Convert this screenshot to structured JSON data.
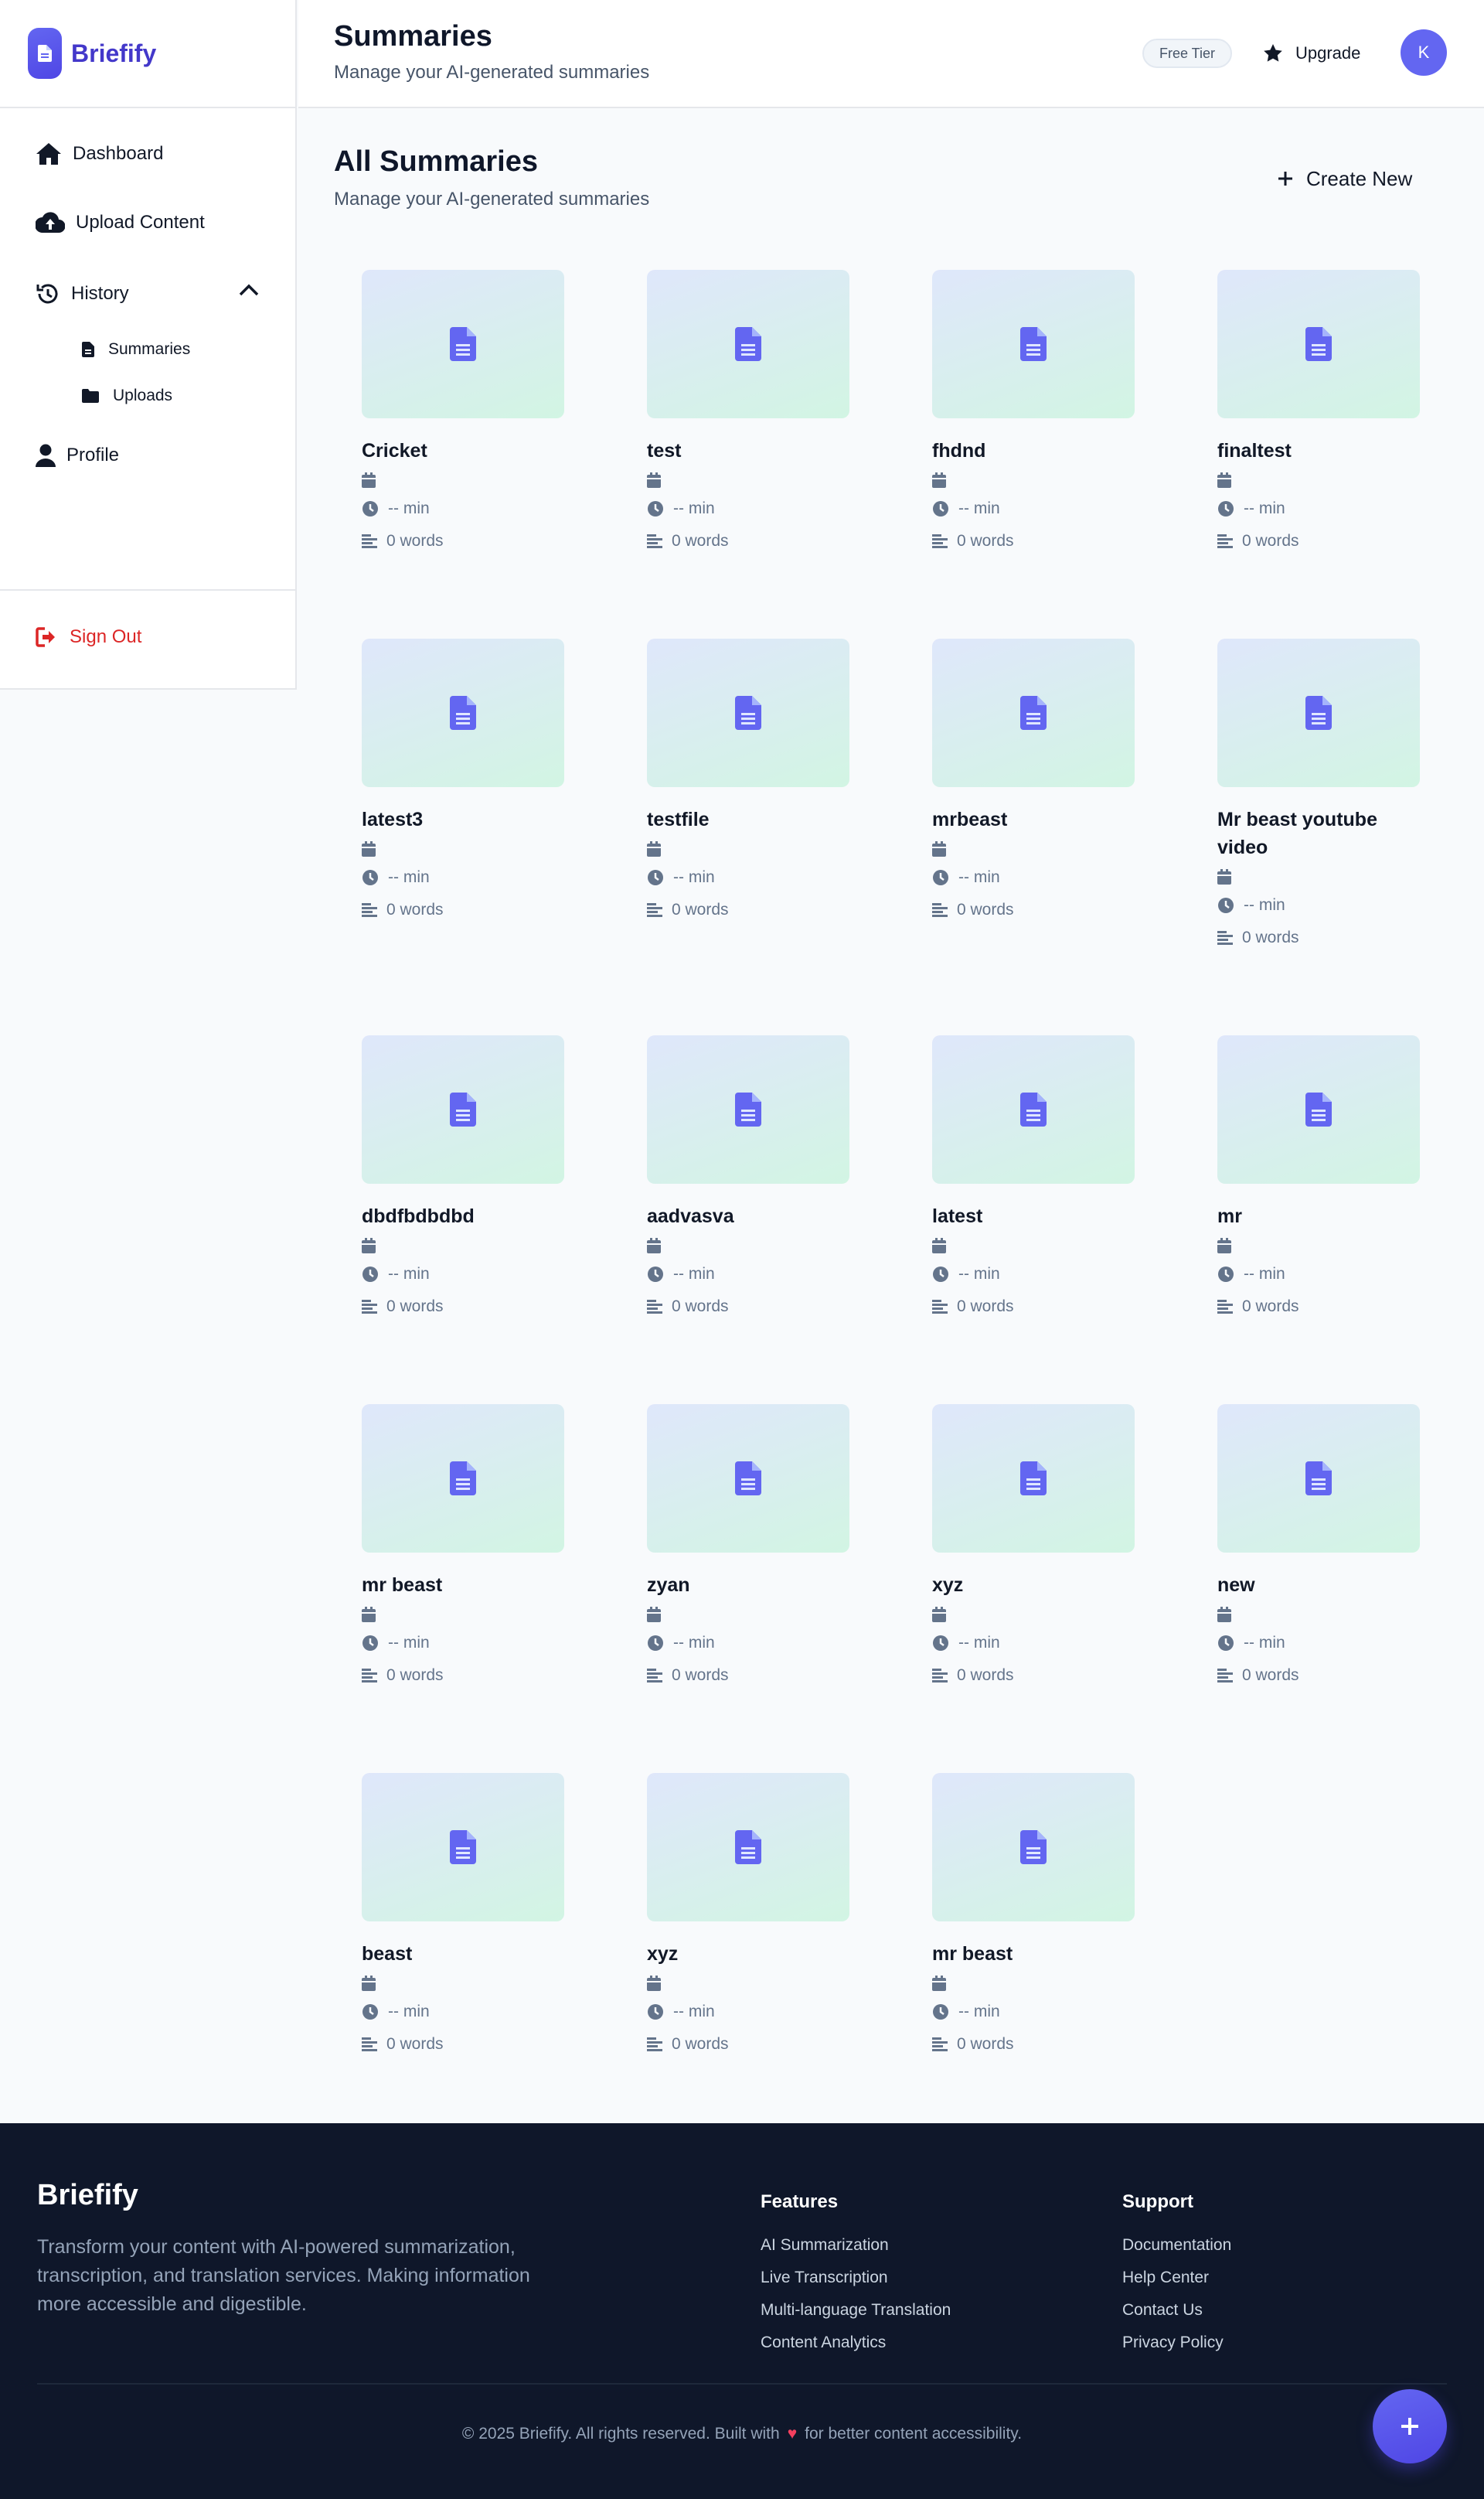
{
  "app": {
    "name": "Briefify"
  },
  "sidebar": {
    "dashboard": "Dashboard",
    "upload": "Upload Content",
    "history": "History",
    "summaries": "Summaries",
    "uploads": "Uploads",
    "profile": "Profile",
    "signout": "Sign Out"
  },
  "header": {
    "title": "Summaries",
    "subtitle": "Manage your AI-generated summaries",
    "tier": "Free Tier",
    "upgrade": "Upgrade",
    "avatar": "K"
  },
  "main": {
    "title": "All Summaries",
    "subtitle": "Manage your AI-generated summaries",
    "create": "Create New"
  },
  "cards": [
    {
      "title": "Cricket",
      "duration": "-- min",
      "words": "0 words"
    },
    {
      "title": "test",
      "duration": "-- min",
      "words": "0 words"
    },
    {
      "title": "fhdnd",
      "duration": "-- min",
      "words": "0 words"
    },
    {
      "title": "finaltest",
      "duration": "-- min",
      "words": "0 words"
    },
    {
      "title": "latest3",
      "duration": "-- min",
      "words": "0 words"
    },
    {
      "title": "testfile",
      "duration": "-- min",
      "words": "0 words"
    },
    {
      "title": "mrbeast",
      "duration": "-- min",
      "words": "0 words"
    },
    {
      "title": "Mr beast youtube video",
      "duration": "-- min",
      "words": "0 words"
    },
    {
      "title": "dbdfbdbdbd",
      "duration": "-- min",
      "words": "0 words"
    },
    {
      "title": "aadvasva",
      "duration": "-- min",
      "words": "0 words"
    },
    {
      "title": "latest",
      "duration": "-- min",
      "words": "0 words"
    },
    {
      "title": "mr",
      "duration": "-- min",
      "words": "0 words"
    },
    {
      "title": "mr beast",
      "duration": "-- min",
      "words": "0 words"
    },
    {
      "title": "zyan",
      "duration": "-- min",
      "words": "0 words"
    },
    {
      "title": "xyz",
      "duration": "-- min",
      "words": "0 words"
    },
    {
      "title": "new",
      "duration": "-- min",
      "words": "0 words"
    },
    {
      "title": "beast",
      "duration": "-- min",
      "words": "0 words"
    },
    {
      "title": "xyz",
      "duration": "-- min",
      "words": "0 words"
    },
    {
      "title": "mr beast",
      "duration": "-- min",
      "words": "0 words"
    }
  ],
  "footer": {
    "brand": "Briefify",
    "description": "Transform your content with AI-powered summarization, transcription, and translation services. Making information more accessible and digestible.",
    "features_title": "Features",
    "features": [
      "AI Summarization",
      "Live Transcription",
      "Multi-language Translation",
      "Content Analytics"
    ],
    "support_title": "Support",
    "support": [
      "Documentation",
      "Help Center",
      "Contact Us",
      "Privacy Policy"
    ],
    "copyright_before": "© 2025 Briefify. All rights reserved. Built with",
    "copyright_after": "for better content accessibility."
  },
  "colors": {
    "accent": "#6366f1",
    "danger": "#dc2626",
    "footer_bg": "#0f172a"
  }
}
